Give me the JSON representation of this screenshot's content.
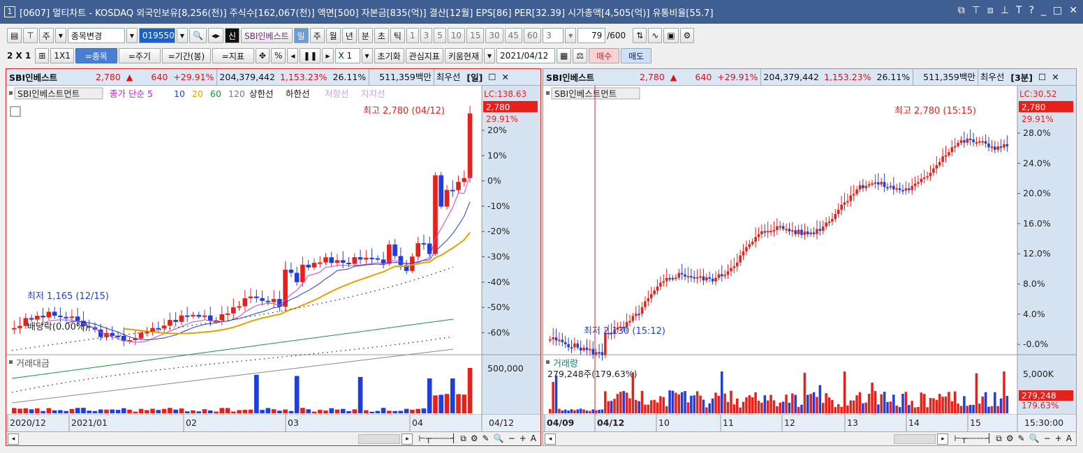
{
  "window": {
    "number": "1",
    "title": "[0607] 멀티차트 - KOSDAQ 외국인보유[8,256(천)] 주식수[162,067(천)] 액면[500] 자본금[835(억)] 결산[12월] EPS[86] PER[32.39] 시가총액[4,505(억)] 유통비율[55.7]"
  },
  "toolbar1": {
    "type_label": "주",
    "change_label": "종목변경",
    "code": "019550",
    "credit_badge": "신",
    "stock_name": "SBI인베스트",
    "periods": [
      "일",
      "주",
      "월",
      "년",
      "분",
      "초",
      "틱"
    ],
    "active_period": "일",
    "intervals": [
      "1",
      "3",
      "5",
      "10",
      "15",
      "30",
      "45",
      "60"
    ],
    "interval_value": "3",
    "count_value": "79",
    "count_total": "/600"
  },
  "toolbar2": {
    "grid_label": "2 X 1",
    "one_label": "1X1",
    "buttons": [
      "=종목",
      "=주기",
      "=기간(봉)",
      "=지표"
    ],
    "percent": "%",
    "mult": "X 1",
    "reset": "초기화",
    "watch": "관심지표",
    "kiwoom": "키움현재",
    "date": "2021/04/12",
    "buy": "매수",
    "sell": "매도"
  },
  "left_panel": {
    "name": "SBI인베스트",
    "price": "2,780",
    "change": "640",
    "change_pct": "+29.91%",
    "volume": "204,379,442",
    "vol_pct": "1,153.23%",
    "turnover": "26.11%",
    "amount": "511,359백만",
    "quote": "최우선",
    "period_tag": "[일]",
    "legend_name": "SBI인베스트먼트",
    "legend_ma": "종가 단순 5",
    "ma": [
      "10",
      "20",
      "60",
      "120"
    ],
    "upper": "상한선",
    "lower": "하한선",
    "resist": "저항선",
    "support": "지지선",
    "lc": "LC:138.63",
    "price_tag": "2,780",
    "pct_tag": "29.91%",
    "high_label": "최고 2,780 (04/12)",
    "low_label": "최저 1,165 (12/15)",
    "div_label": "배당락(0.00%)",
    "vol_title": "거래대금",
    "vol_axis": "500,000",
    "axis": [
      "20%",
      "10%",
      "0%",
      "-10%",
      "-20%",
      "-30%",
      "-40%",
      "-50%",
      "-60%"
    ],
    "xlabels": [
      "2020/12",
      "2021/01",
      "02",
      "03",
      "04"
    ],
    "xend": "04/12"
  },
  "right_panel": {
    "name": "SBI인베스트",
    "price": "2,780",
    "change": "640",
    "change_pct": "+29.91%",
    "volume": "204,379,442",
    "vol_pct": "1,153.23%",
    "turnover": "26.11%",
    "amount": "511,359백만",
    "quote": "최우선",
    "period_tag": "[3분]",
    "legend_name": "SBI인베스트먼트",
    "lc": "LC:30.52",
    "price_tag": "2,780",
    "pct_tag": "29.91%",
    "high_label": "최고 2,780 (15:15)",
    "low_label": "최저 2,130 (15:12)",
    "vol_title": "거래량",
    "vol_sub": "279,248주(179.63%)",
    "vol_axis": "5,000K",
    "vol_tag": "279,248",
    "vol_tag_pct": "179.63%",
    "axis": [
      "28.0%",
      "24.0%",
      "20.0%",
      "16.0%",
      "12.0%",
      "8.0%",
      "4.0%",
      "-0.0%"
    ],
    "xlabels": [
      "04/09",
      "04/12",
      "10",
      "11",
      "12",
      "13",
      "14",
      "15"
    ],
    "xend": "15:30:00"
  },
  "colors": {
    "up": "#e8201c",
    "down": "#1f3fd8",
    "title": "#3f5f93"
  }
}
